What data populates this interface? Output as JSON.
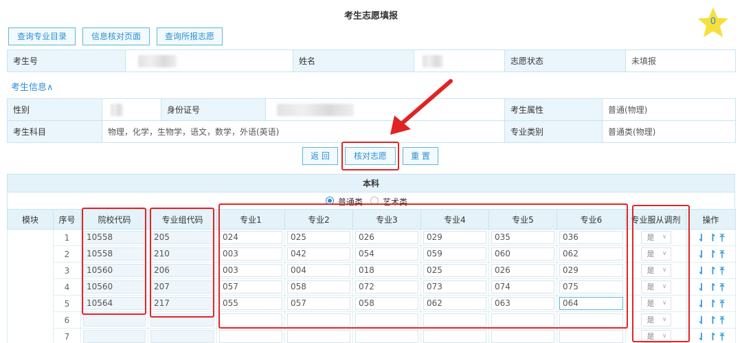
{
  "page": {
    "title": "考生志愿填报",
    "star_count": "0"
  },
  "toolbar": {
    "btn1": "查询专业目录",
    "btn2": "信息核对页面",
    "btn3": "查询所报志愿"
  },
  "status_row": {
    "exam_no_label": "考生号",
    "name_label": "姓名",
    "status_label": "志愿状态",
    "status_value": "未填报"
  },
  "section": {
    "toggle_label": "考生信息∧"
  },
  "info": {
    "gender_label": "性别",
    "id_label": "身份证号",
    "attr_label": "考生属性",
    "attr_value": "普通(物理)",
    "subjects_label": "考生科目",
    "subjects_value": "物理，化学，生物学，语文，数学，外语(英语)",
    "major_type_label": "专业类别",
    "major_type_value": "普通类(物理)"
  },
  "actions": {
    "back": "返 回",
    "verify": "核对志愿",
    "reset": "重 置"
  },
  "section_title": "本科",
  "type_options": {
    "normal": "普通类",
    "art": "艺术类"
  },
  "columns": [
    "模块",
    "序号",
    "院校代码",
    "专业组代码",
    "专业1",
    "专业2",
    "专业3",
    "专业4",
    "专业5",
    "专业6",
    "专业服从调剂",
    "操作"
  ],
  "rows": [
    {
      "seq": "1",
      "school": "10558",
      "group": "205",
      "m1": "024",
      "m2": "025",
      "m3": "026",
      "m4": "029",
      "m5": "035",
      "m6": "036",
      "adjust": "是"
    },
    {
      "seq": "2",
      "school": "10558",
      "group": "210",
      "m1": "003",
      "m2": "042",
      "m3": "054",
      "m4": "059",
      "m5": "060",
      "m6": "062",
      "adjust": "是"
    },
    {
      "seq": "3",
      "school": "10560",
      "group": "206",
      "m1": "003",
      "m2": "004",
      "m3": "018",
      "m4": "025",
      "m5": "026",
      "m6": "029",
      "adjust": "是"
    },
    {
      "seq": "4",
      "school": "10560",
      "group": "207",
      "m1": "057",
      "m2": "058",
      "m3": "072",
      "m4": "073",
      "m5": "074",
      "m6": "075",
      "adjust": "是"
    },
    {
      "seq": "5",
      "school": "10564",
      "group": "217",
      "m1": "055",
      "m2": "057",
      "m3": "058",
      "m4": "062",
      "m5": "063",
      "m6": "064",
      "adjust": "是"
    },
    {
      "seq": "6",
      "school": "",
      "group": "",
      "m1": "",
      "m2": "",
      "m3": "",
      "m4": "",
      "m5": "",
      "m6": "",
      "adjust": "是"
    },
    {
      "seq": "7",
      "school": "",
      "group": "",
      "m1": "",
      "m2": "",
      "m3": "",
      "m4": "",
      "m5": "",
      "m6": "",
      "adjust": "是"
    }
  ],
  "op_icons": [
    "move-down-icon",
    "move-up-icon",
    "move-top-icon"
  ],
  "colors": {
    "accent": "#2a8fd6",
    "header_bg": "#e4f3f9",
    "annotation": "#e02424",
    "star": "#f7df3c"
  }
}
